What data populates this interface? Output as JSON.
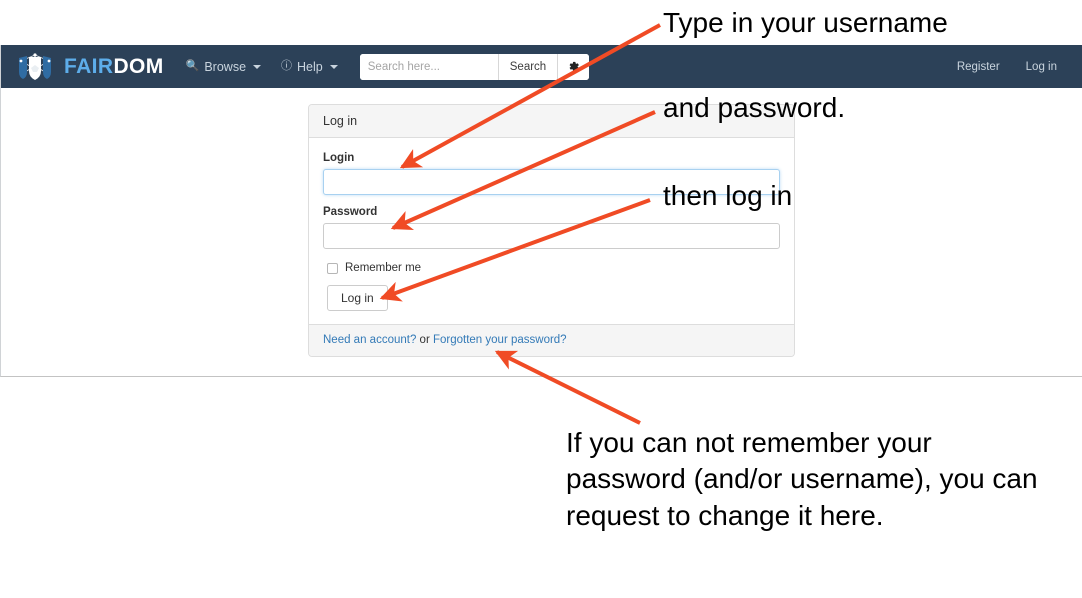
{
  "navbar": {
    "brand": {
      "fair": "FAIR",
      "dom": "DOM",
      "logo_icon": "fairdom-shield-handshake-logo"
    },
    "items": [
      {
        "label": "Browse",
        "icon": "search-icon",
        "has_caret": true
      },
      {
        "label": "Help",
        "icon": "info-circle-icon",
        "has_caret": true
      }
    ],
    "search": {
      "placeholder": "Search here...",
      "value": "",
      "button_label": "Search",
      "settings_icon": "gear-icon"
    },
    "right_links": [
      {
        "label": "Register"
      },
      {
        "label": "Log in"
      }
    ],
    "background_color": "#2c4158"
  },
  "panel": {
    "heading": "Log in",
    "login": {
      "label": "Login",
      "value": "",
      "placeholder": ""
    },
    "password": {
      "label": "Password",
      "value": "",
      "placeholder": ""
    },
    "remember": {
      "label": "Remember me",
      "checked": false
    },
    "submit_label": "Log in",
    "footer": {
      "need_account": "Need an account?",
      "separator": " or ",
      "forgotten_password": "Forgotten your password?",
      "link_color": "#337ab7"
    }
  },
  "annotations": {
    "arrow_color": "#f04b25",
    "username": "Type in your username",
    "password": "and password.",
    "then_log_in": "then log in",
    "forgotten": "If you can not remember your password (and/or username), you can request to change it here."
  }
}
